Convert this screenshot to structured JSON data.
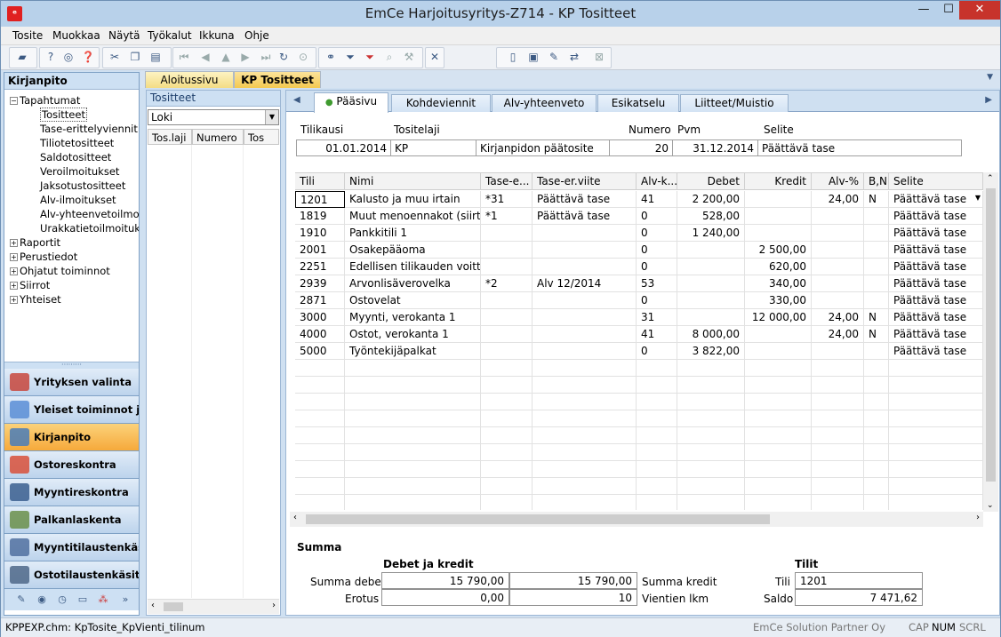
{
  "window": {
    "title": "EmCe  Harjoitusyritys-Z714 - KP Tositteet",
    "minimize": "—",
    "maximize": "☐",
    "close": "✕"
  },
  "menu": [
    "Tosite",
    "Muokkaa",
    "Näytä",
    "Työkalut",
    "Ikkuna",
    "Ohje"
  ],
  "doc_tabs": [
    "Aloitussivu",
    "KP Tositteet"
  ],
  "sidebar": {
    "title": "Kirjanpito",
    "tree": [
      {
        "label": "Tapahtumat",
        "toggle": "−",
        "level": 0
      },
      {
        "label": "Tositteet",
        "level": 1,
        "selected": true
      },
      {
        "label": "Tase-erittelyviennit",
        "level": 1
      },
      {
        "label": "Tiliotetositteet",
        "level": 1
      },
      {
        "label": "Saldotositteet",
        "level": 1
      },
      {
        "label": "Veroilmoitukset",
        "level": 1
      },
      {
        "label": "Jaksotustositteet",
        "level": 1
      },
      {
        "label": "Alv-ilmoitukset",
        "level": 1
      },
      {
        "label": "Alv-yhteenvetoilmoitu",
        "level": 1
      },
      {
        "label": "Urakkatietoilmoitukse",
        "level": 1
      },
      {
        "label": "Raportit",
        "toggle": "+",
        "level": 0
      },
      {
        "label": "Perustiedot",
        "toggle": "+",
        "level": 0
      },
      {
        "label": "Ohjatut toiminnot",
        "toggle": "+",
        "level": 0
      },
      {
        "label": "Siirrot",
        "toggle": "+",
        "level": 0
      },
      {
        "label": "Yhteiset",
        "toggle": "+",
        "level": 0
      }
    ],
    "nav": [
      {
        "label": "Yrityksen valinta",
        "icon": "company-icon",
        "color": "#c8473c"
      },
      {
        "label": "Yleiset toiminnot ja a...",
        "icon": "globe-icon",
        "color": "#5b8ed6"
      },
      {
        "label": "Kirjanpito",
        "icon": "chart-icon",
        "color": "#4a7db8",
        "selected": true
      },
      {
        "label": "Ostoreskontra",
        "icon": "pie-icon",
        "color": "#d8503a"
      },
      {
        "label": "Myyntireskontra",
        "icon": "euro-icon",
        "color": "#3b5f8f"
      },
      {
        "label": "Palkanlaskenta",
        "icon": "payroll-chart-icon",
        "color": "#6a8f4a"
      },
      {
        "label": "Myyntitilaustenkäsitt...",
        "icon": "sales-orders-icon",
        "color": "#5070a0"
      },
      {
        "label": "Ostotilaustenkäsittely",
        "icon": "calculator-icon",
        "color": "#4d6788"
      }
    ]
  },
  "list_panel": {
    "title": "Tositteet",
    "filter": "Loki",
    "columns": [
      "Tos.laji",
      "Numero",
      "Tos"
    ]
  },
  "subtabs": [
    "Pääsivu",
    "Kohdeviennit",
    "Alv-yhteenveto",
    "Esikatselu",
    "Liitteet/Muistio"
  ],
  "header": {
    "labels": {
      "tilikausi": "Tilikausi",
      "tositelaji": "Tositelaji",
      "numero": "Numero",
      "pvm": "Pvm",
      "selite": "Selite"
    },
    "values": {
      "tilikausi": "01.01.2014",
      "laji_code": "KP",
      "laji_name": "Kirjanpidon päätosite",
      "numero": "20",
      "pvm": "31.12.2014",
      "selite": "Päättävä tase"
    }
  },
  "grid": {
    "columns": [
      "Tili",
      "Nimi",
      "Tase-e...",
      "Tase-er.viite",
      "Alv-k...",
      "Debet",
      "Kredit",
      "Alv-%",
      "B,N",
      "Selite"
    ],
    "rows": [
      [
        "1201",
        "Kalusto ja muu irtain",
        "*31",
        "Päättävä tase",
        "41",
        "2 200,00",
        "",
        "24,00",
        "N",
        "Päättävä tase"
      ],
      [
        "1819",
        "Muut menoennakot (siirtos",
        "*1",
        "Päättävä tase",
        "0",
        "528,00",
        "",
        "",
        "",
        "Päättävä tase"
      ],
      [
        "1910",
        "Pankkitili 1",
        "",
        "",
        "0",
        "1 240,00",
        "",
        "",
        "",
        "Päättävä tase"
      ],
      [
        "2001",
        "Osakepääoma",
        "",
        "",
        "0",
        "",
        "2 500,00",
        "",
        "",
        "Päättävä tase"
      ],
      [
        "2251",
        "Edellisen tilikauden voitto/t",
        "",
        "",
        "0",
        "",
        "620,00",
        "",
        "",
        "Päättävä tase"
      ],
      [
        "2939",
        "Arvonlisäverovelka",
        "*2",
        "Alv 12/2014",
        "53",
        "",
        "340,00",
        "",
        "",
        "Päättävä tase"
      ],
      [
        "2871",
        "Ostovelat",
        "",
        "",
        "0",
        "",
        "330,00",
        "",
        "",
        "Päättävä tase"
      ],
      [
        "3000",
        "Myynti, verokanta 1",
        "",
        "",
        "31",
        "",
        "12 000,00",
        "24,00",
        "N",
        "Päättävä tase"
      ],
      [
        "4000",
        "Ostot, verokanta 1",
        "",
        "",
        "41",
        "8 000,00",
        "",
        "24,00",
        "N",
        "Päättävä tase"
      ],
      [
        "5000",
        "Työntekijäpalkat",
        "",
        "",
        "0",
        "3 822,00",
        "",
        "",
        "",
        "Päättävä tase"
      ]
    ]
  },
  "summary": {
    "title": "Summa",
    "section_dk": "Debet ja kredit",
    "section_tilit": "Tilit",
    "summa_debet_label": "Summa debet",
    "summa_debet": "15 790,00",
    "summa_kredit_label": "Summa kredit",
    "summa_kredit": "15 790,00",
    "erotus_label": "Erotus",
    "erotus": "0,00",
    "vientien_label": "Vientien lkm",
    "vientien_lkm": "10",
    "tili_label": "Tili",
    "tili": "1201",
    "saldo_label": "Saldo",
    "saldo": "7 471,62"
  },
  "statusbar": {
    "left": "KPPEXP.chm: KpTosite_KpVienti_tilinum",
    "partner": "EmCe Solution Partner Oy",
    "caps": "CAP",
    "num": "NUM",
    "scrl": "SCRL"
  }
}
